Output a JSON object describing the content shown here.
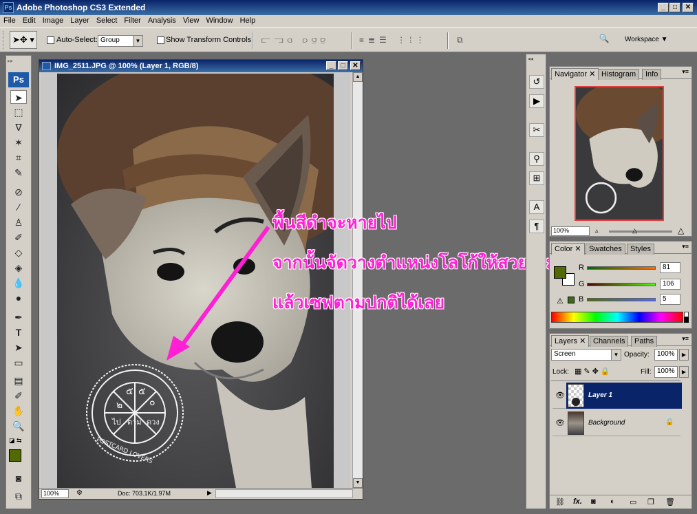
{
  "app": {
    "title": "Adobe Photoshop CS3 Extended",
    "ps_badge": "Ps"
  },
  "menu": [
    "File",
    "Edit",
    "Image",
    "Layer",
    "Select",
    "Filter",
    "Analysis",
    "View",
    "Window",
    "Help"
  ],
  "options": {
    "auto_select_label": "Auto-Select:",
    "auto_select_value": "Group",
    "show_transform_label": "Show Transform Controls",
    "workspace_label": "Workspace"
  },
  "toolbox": {
    "badge": "Ps"
  },
  "document": {
    "title": "IMG_2511.JPG @ 100% (Layer 1, RGB/8)",
    "zoom": "100%",
    "doc_info": "Doc: 703.1K/1.97M"
  },
  "annotations": {
    "line1": "พื้นสีดำจะหายไป",
    "line2": "จากนั้นจัดวางตำแหน่งโลโก้ให้สวยงาม",
    "line3": "แล้วเซฟตามปกติได้เลย",
    "arrow_color": "#ff1fd4"
  },
  "stamp": {
    "digits": [
      "๒",
      "๕",
      "๕",
      "๐"
    ],
    "words": [
      "ไป",
      "ตาม",
      "ดวง"
    ],
    "ring_text": "POSTCARD LOVERS"
  },
  "navigator": {
    "tabs": [
      "Navigator",
      "Histogram",
      "Info"
    ],
    "zoom": "100%"
  },
  "color": {
    "tabs": [
      "Color",
      "Swatches",
      "Styles"
    ],
    "r_label": "R",
    "g_label": "G",
    "b_label": "B",
    "r": "81",
    "g": "106",
    "b": "5",
    "fg_color": "#516a05"
  },
  "layers": {
    "tabs": [
      "Layers",
      "Channels",
      "Paths"
    ],
    "blend_mode": "Screen",
    "opacity_label": "Opacity:",
    "opacity": "100%",
    "lock_label": "Lock:",
    "fill_label": "Fill:",
    "fill": "100%",
    "items": [
      {
        "name": "Layer 1"
      },
      {
        "name": "Background"
      }
    ],
    "footer_fx": "fx."
  }
}
